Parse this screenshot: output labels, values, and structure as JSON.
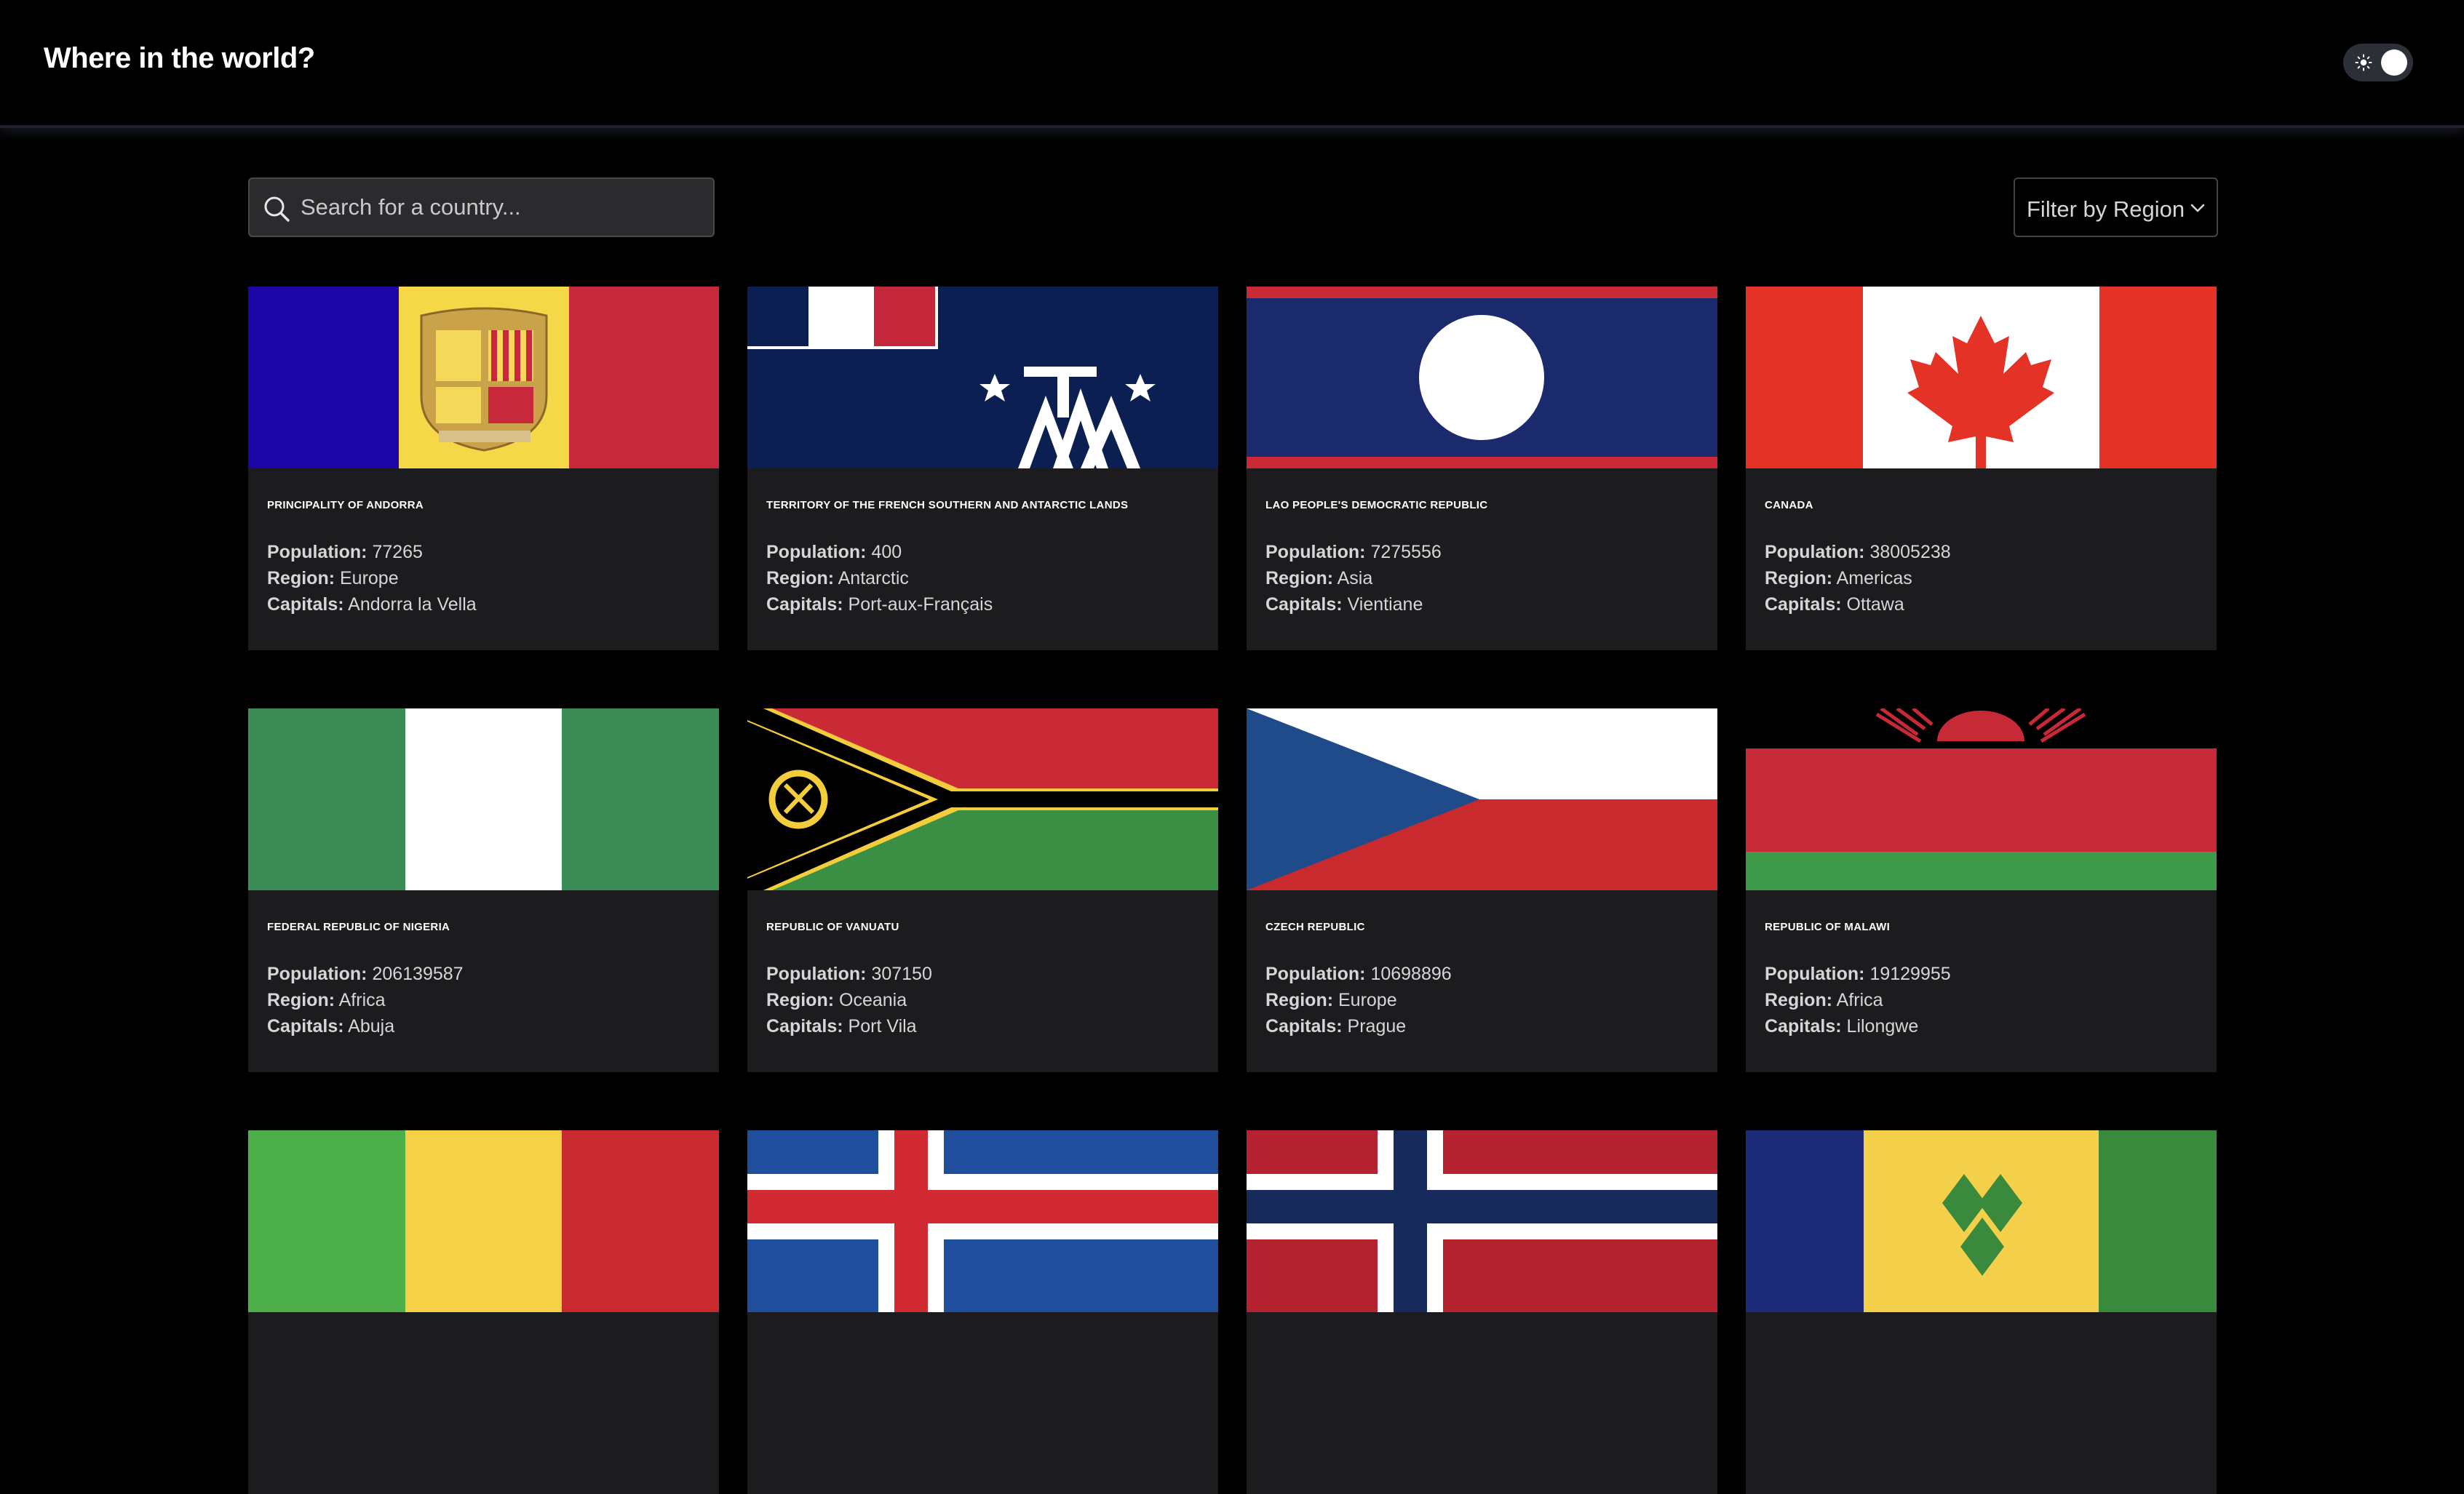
{
  "header": {
    "title": "Where in the world?",
    "theme_toggle_icon": "sun-icon"
  },
  "search": {
    "placeholder": "Search for a country...",
    "value": ""
  },
  "filter": {
    "label": "Filter by Region"
  },
  "labels": {
    "population": "Population:",
    "region": "Region:",
    "capitals": "Capitals:"
  },
  "countries": [
    {
      "name": "PRINCIPALITY OF ANDORRA",
      "population": "77265",
      "region": "Europe",
      "capitals": "Andorra la Vella"
    },
    {
      "name": "TERRITORY OF THE FRENCH SOUTHERN AND ANTARCTIC LANDS",
      "population": "400",
      "region": "Antarctic",
      "capitals": "Port-aux-Français"
    },
    {
      "name": "LAO PEOPLE'S DEMOCRATIC REPUBLIC",
      "population": "7275556",
      "region": "Asia",
      "capitals": "Vientiane"
    },
    {
      "name": "CANADA",
      "population": "38005238",
      "region": "Americas",
      "capitals": "Ottawa"
    },
    {
      "name": "FEDERAL REPUBLIC OF NIGERIA",
      "population": "206139587",
      "region": "Africa",
      "capitals": "Abuja"
    },
    {
      "name": "REPUBLIC OF VANUATU",
      "population": "307150",
      "region": "Oceania",
      "capitals": "Port Vila"
    },
    {
      "name": "CZECH REPUBLIC",
      "population": "10698896",
      "region": "Europe",
      "capitals": "Prague"
    },
    {
      "name": "REPUBLIC OF MALAWI",
      "population": "19129955",
      "region": "Africa",
      "capitals": "Lilongwe"
    },
    {
      "name": "",
      "population": "",
      "region": "",
      "capitals": ""
    },
    {
      "name": "",
      "population": "",
      "region": "",
      "capitals": ""
    },
    {
      "name": "",
      "population": "",
      "region": "",
      "capitals": ""
    },
    {
      "name": "",
      "population": "",
      "region": "",
      "capitals": ""
    }
  ]
}
